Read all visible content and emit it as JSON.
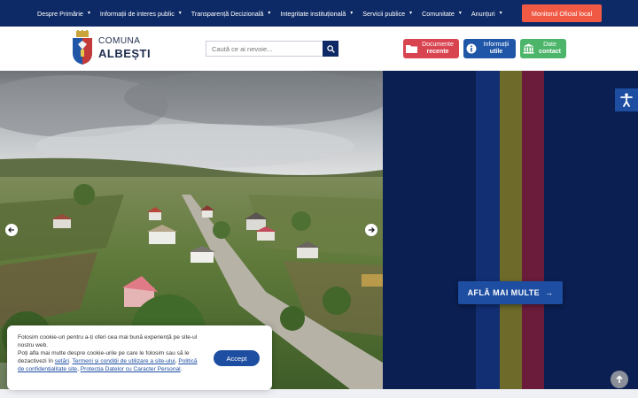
{
  "nav": {
    "items": [
      {
        "label": "Despre Primărie"
      },
      {
        "label": "Informații de interes public"
      },
      {
        "label": "Transparență Decizională"
      },
      {
        "label": "Integritate instituțională"
      },
      {
        "label": "Servicii publice"
      },
      {
        "label": "Comunitate"
      },
      {
        "label": "Anunțuri"
      }
    ],
    "monitor_label": "Monitorul Oficial local"
  },
  "logo": {
    "line1": "COMUNA",
    "line2": "ALBEȘTI"
  },
  "search": {
    "placeholder": "Caută ce ai nevoie..."
  },
  "quick_links": [
    {
      "line1": "Documente",
      "line2": "recente",
      "icon": "folder-icon",
      "color": "#d94451"
    },
    {
      "line1": "Informații",
      "line2": "utile",
      "icon": "info-icon",
      "color": "#1f56a8"
    },
    {
      "line1": "Date",
      "line2": "contact",
      "icon": "institution-icon",
      "color": "#4cb56a"
    }
  ],
  "hero": {
    "cta_label": "AFLĂ MAI MULTE",
    "cta_arrow": "→"
  },
  "cookie": {
    "line1": "Folosim cookie-uri pentru a-ți oferi cea mai bună experiență pe site-ul nostru web.",
    "line2a": "Poți afla mai multe despre cookie-urile pe care le folosim sau să le dezactivezi în ",
    "link_settings": "setări",
    "link_terms": "Termeni și condiții de utilizare a site-ului",
    "link_privacy": "Politică de confidențialitate site",
    "link_gdpr": "Protecția Datelor cu Caracter Personal",
    "accept_label": "Accept"
  },
  "colors": {
    "nav_bg": "#0e2a66",
    "accent_red": "#f05a45",
    "brand_blue": "#1d4ea1",
    "hero_band_dark": "#0b1f52"
  }
}
